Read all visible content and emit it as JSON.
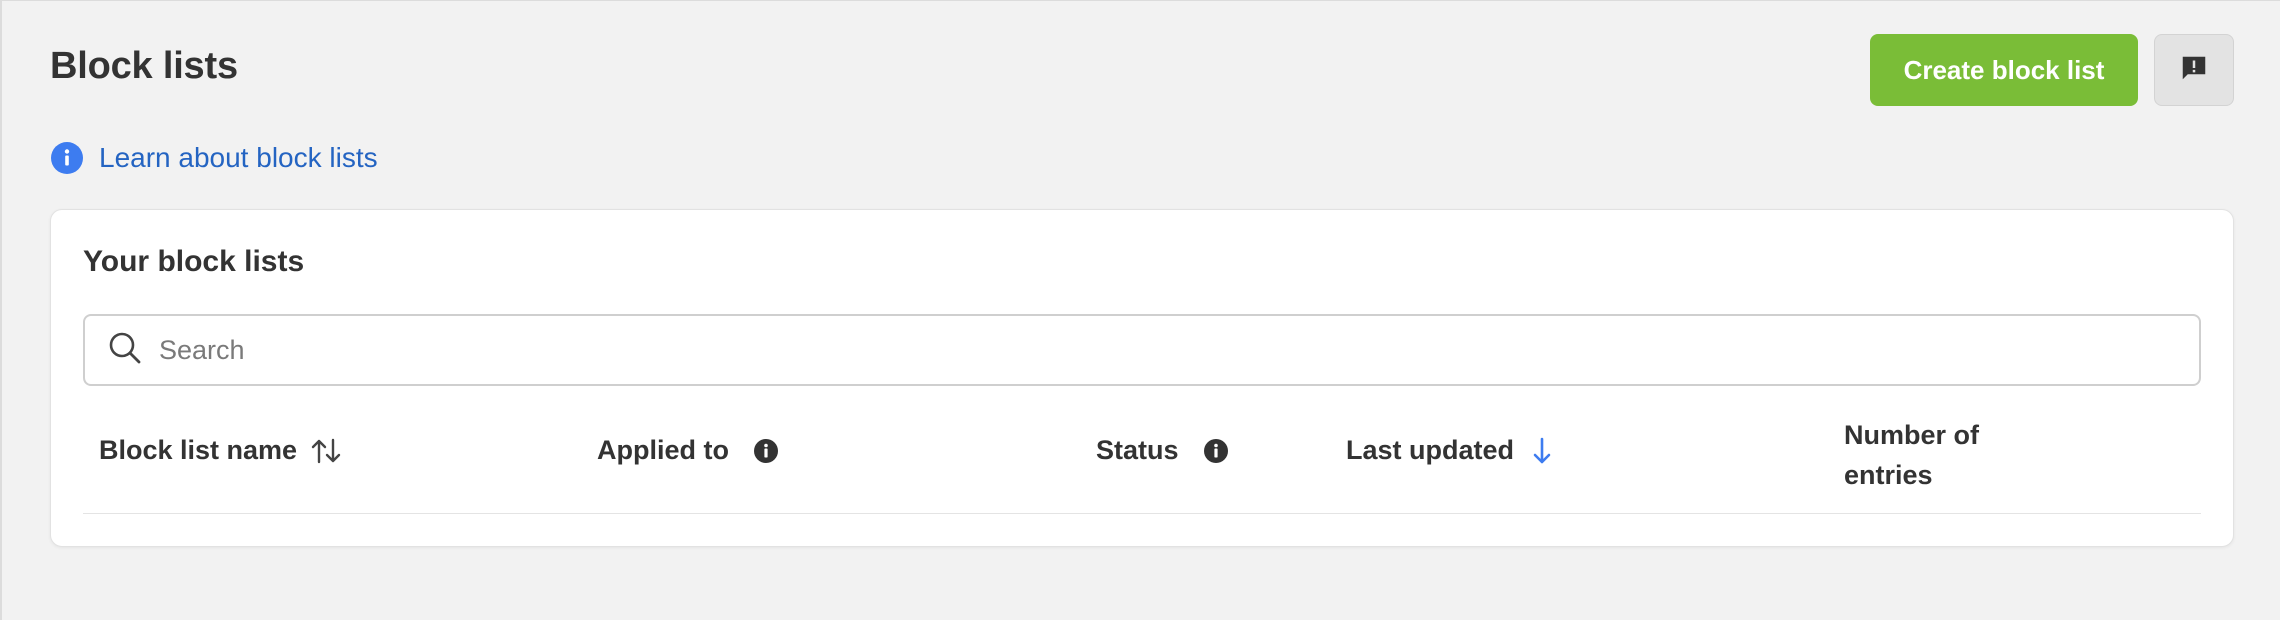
{
  "header": {
    "title": "Block lists",
    "create_button_label": "Create block list",
    "feedback_icon": "feedback-exclamation-icon"
  },
  "learn": {
    "icon": "info-icon",
    "link_text": "Learn about block lists"
  },
  "card": {
    "title": "Your block lists",
    "search": {
      "placeholder": "Search",
      "value": ""
    },
    "table": {
      "columns": [
        {
          "label": "Block list name",
          "icon": "sort-both-icon"
        },
        {
          "label": "Applied to",
          "icon": "info-icon"
        },
        {
          "label": "Status",
          "icon": "info-icon"
        },
        {
          "label": "Last updated",
          "icon": "sort-descending-icon"
        },
        {
          "label": "Number of entries",
          "line1": "Number of",
          "line2": "entries"
        }
      ],
      "rows": []
    }
  },
  "colors": {
    "accent_green": "#7abd37",
    "link_blue": "#2464c2",
    "info_blue": "#3d7cf0",
    "sort_active_blue": "#3d7cf0",
    "page_background": "#f2f2f2"
  }
}
